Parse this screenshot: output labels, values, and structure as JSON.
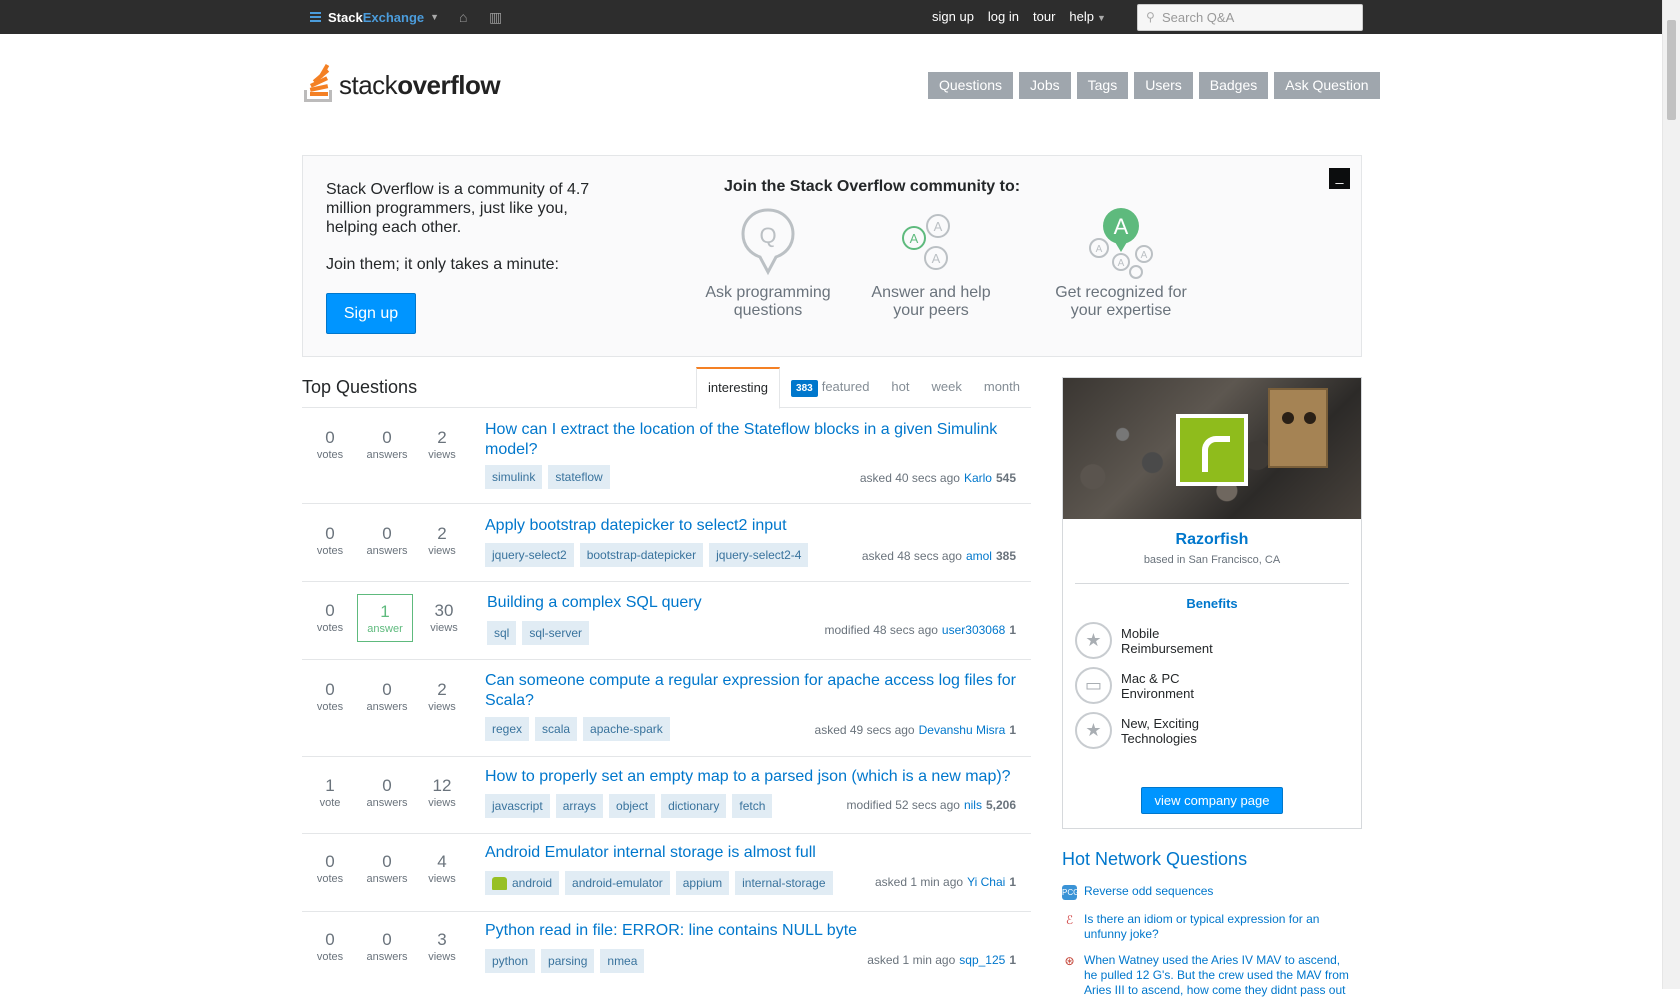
{
  "topbar": {
    "brand_a": "Stack",
    "brand_b": "Exchange",
    "links": [
      "sign up",
      "log in",
      "tour",
      "help"
    ],
    "search_placeholder": "Search Q&A"
  },
  "header": {
    "logo_light": "stack",
    "logo_bold": "overflow",
    "nav": [
      "Questions",
      "Jobs",
      "Tags",
      "Users",
      "Badges",
      "Ask Question"
    ]
  },
  "welcome": {
    "intro": "Stack Overflow is a community of 4.7 million programmers, just like you, helping each other.",
    "join_text": "Join them; it only takes a minute:",
    "signup_label": "Sign up",
    "join_title": "Join the Stack Overflow community to:",
    "close_label": "_",
    "features": [
      {
        "text": "Ask programming questions",
        "icon": "Q"
      },
      {
        "text": "Answer and help your peers",
        "icon": "A"
      },
      {
        "text": "Get recognized for your expertise",
        "icon": "A"
      }
    ]
  },
  "questions": {
    "heading": "Top Questions",
    "tabs": [
      {
        "label": "interesting",
        "active": true
      },
      {
        "label": "featured",
        "badge": "383"
      },
      {
        "label": "hot"
      },
      {
        "label": "week"
      },
      {
        "label": "month"
      }
    ],
    "items": [
      {
        "votes": "0",
        "votes_label": "votes",
        "answers": "0",
        "answers_label": "answers",
        "views": "2",
        "views_label": "views",
        "title": "How can I extract the location of the Stateflow blocks in a given Simulink model?",
        "tags": [
          "simulink",
          "stateflow"
        ],
        "action": "asked 40 secs ago",
        "user": "Karlo",
        "rep": "545",
        "accepted": false
      },
      {
        "votes": "0",
        "votes_label": "votes",
        "answers": "0",
        "answers_label": "answers",
        "views": "2",
        "views_label": "views",
        "title": "Apply bootstrap datepicker to select2 input",
        "tags": [
          "jquery-select2",
          "bootstrap-datepicker",
          "jquery-select2-4"
        ],
        "action": "asked 48 secs ago",
        "user": "amol",
        "rep": "385",
        "accepted": false
      },
      {
        "votes": "0",
        "votes_label": "votes",
        "answers": "1",
        "answers_label": "answer",
        "views": "30",
        "views_label": "views",
        "title": "Building a complex SQL query",
        "tags": [
          "sql",
          "sql-server"
        ],
        "action": "modified 48 secs ago",
        "user": "user303068",
        "rep": "1",
        "accepted": true
      },
      {
        "votes": "0",
        "votes_label": "votes",
        "answers": "0",
        "answers_label": "answers",
        "views": "2",
        "views_label": "views",
        "title": "Can someone compute a regular expression for apache access log files for Scala?",
        "tags": [
          "regex",
          "scala",
          "apache-spark"
        ],
        "action": "asked 49 secs ago",
        "user": "Devanshu Misra",
        "rep": "1",
        "accepted": false
      },
      {
        "votes": "1",
        "votes_label": "vote",
        "answers": "0",
        "answers_label": "answers",
        "views": "12",
        "views_label": "views",
        "title": "How to properly set an empty map to a parsed json (which is a new map)?",
        "tags": [
          "javascript",
          "arrays",
          "object",
          "dictionary",
          "fetch"
        ],
        "action": "modified 52 secs ago",
        "user": "nils",
        "rep": "5,206",
        "accepted": false
      },
      {
        "votes": "0",
        "votes_label": "votes",
        "answers": "0",
        "answers_label": "answers",
        "views": "4",
        "views_label": "views",
        "title": "Android Emulator internal storage is almost full",
        "tags": [
          "android",
          "android-emulator",
          "appium",
          "internal-storage"
        ],
        "action": "asked 1 min ago",
        "user": "Yi Chai",
        "rep": "1",
        "accepted": false
      },
      {
        "votes": "0",
        "votes_label": "votes",
        "answers": "0",
        "answers_label": "answers",
        "views": "3",
        "views_label": "views",
        "title": "Python read in file: ERROR: line contains NULL byte",
        "tags": [
          "python",
          "parsing",
          "nmea"
        ],
        "action": "asked 1 min ago",
        "user": "sqp_125",
        "rep": "1",
        "accepted": false
      }
    ]
  },
  "company": {
    "name": "Razorfish",
    "location": "based in San Francisco, CA",
    "benefits_title": "Benefits",
    "benefits": [
      {
        "text": "Mobile Reimbursement",
        "icon": "star-icon"
      },
      {
        "text": "Mac & PC Environment",
        "icon": "monitor-icon"
      },
      {
        "text": "New, Exciting Technologies",
        "icon": "star-icon"
      }
    ],
    "button_label": "view company page"
  },
  "hot_network": {
    "title": "Hot Network Questions",
    "items": [
      {
        "text": "Reverse odd sequences",
        "icon_color": "#3a93d6"
      },
      {
        "text": "Is there an idiom or typical expression for an unfunny joke?",
        "icon_color": "#d24b4b"
      },
      {
        "text": "When Watney used the Aries IV MAV to ascend, he pulled 12 G's. But the crew used the MAV from Aries III to ascend, how come they didnt pass out",
        "icon_color": "#c0392b"
      }
    ]
  }
}
